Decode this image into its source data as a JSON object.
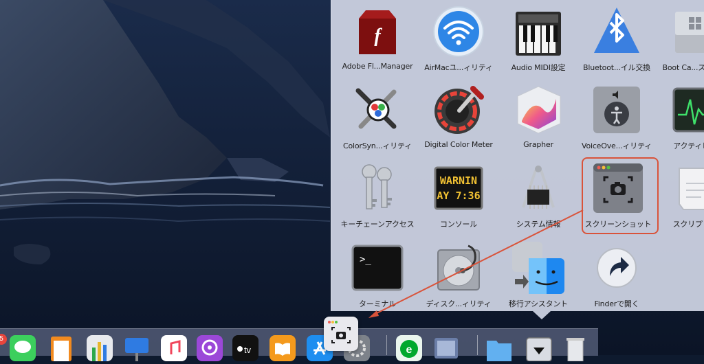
{
  "stack": {
    "items": [
      {
        "label": "Adobe Fl...Manager",
        "icon": "flash-icon"
      },
      {
        "label": "AirMacユ...ィリティ",
        "icon": "wifi-icon"
      },
      {
        "label": "Audio MIDI設定",
        "icon": "piano-icon"
      },
      {
        "label": "Bluetoot...イル交換",
        "icon": "bluetooth-icon"
      },
      {
        "label": "Boot Ca...スタント",
        "icon": "bootcamp-icon"
      },
      {
        "label": "ColorSyn...ィリティ",
        "icon": "colorsync-icon"
      },
      {
        "label": "Digital Color Meter",
        "icon": "eyedropper-icon"
      },
      {
        "label": "Grapher",
        "icon": "grapher-icon"
      },
      {
        "label": "VoiceOve...ィリティ",
        "icon": "voiceover-icon"
      },
      {
        "label": "アクティビテ",
        "icon": "activity-monitor-icon"
      },
      {
        "label": "キーチェーンアクセス",
        "icon": "keychain-icon"
      },
      {
        "label": "コンソール",
        "icon": "console-icon"
      },
      {
        "label": "システム情報",
        "icon": "system-info-icon"
      },
      {
        "label": "スクリーンショット",
        "icon": "screenshot-icon"
      },
      {
        "label": "スクリプトエ",
        "icon": "script-editor-icon"
      },
      {
        "label": "ターミナル",
        "icon": "terminal-icon"
      },
      {
        "label": "ディスク...ィリティ",
        "icon": "disk-utility-icon"
      },
      {
        "label": "移行アシスタント",
        "icon": "migration-icon"
      },
      {
        "label": "Finderで開く",
        "icon": "open-in-finder-icon"
      }
    ],
    "console_text": [
      "WARNIN",
      "AY 7:36"
    ],
    "terminal_prompt": ">_"
  },
  "dock": {
    "badge_count": "5",
    "apple_tv_label": "tv"
  },
  "colors": {
    "highlight": "#d9533a",
    "arrow": "#d9533a"
  }
}
